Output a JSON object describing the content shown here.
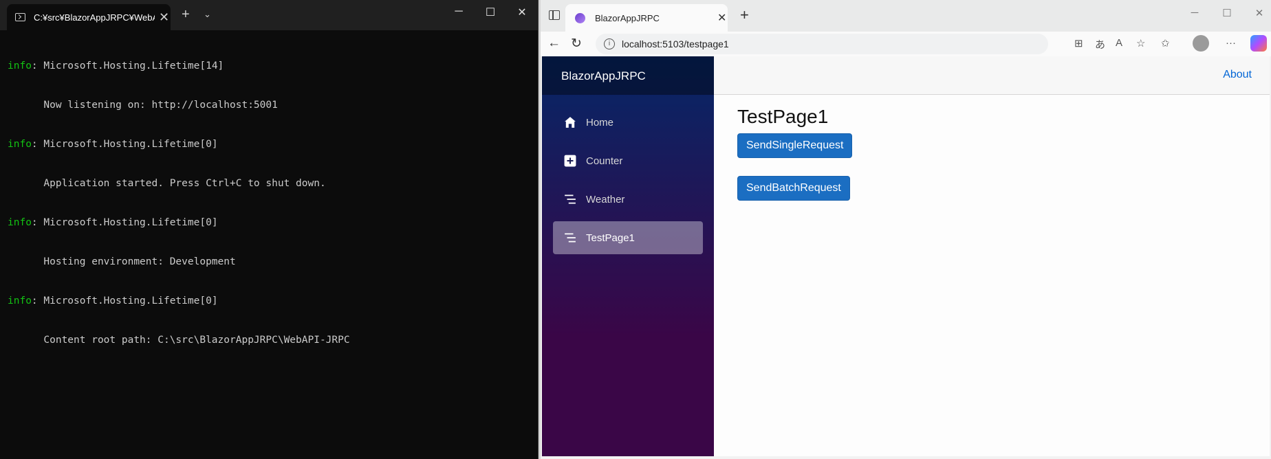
{
  "terminal": {
    "tab_title": "C:¥src¥BlazorAppJRPC¥WebAI",
    "lines": [
      {
        "level": "info",
        "text": ": Microsoft.Hosting.Lifetime[14]"
      },
      {
        "level": "",
        "text": "      Now listening on: http://localhost:5001"
      },
      {
        "level": "info",
        "text": ": Microsoft.Hosting.Lifetime[0]"
      },
      {
        "level": "",
        "text": "      Application started. Press Ctrl+C to shut down."
      },
      {
        "level": "info",
        "text": ": Microsoft.Hosting.Lifetime[0]"
      },
      {
        "level": "",
        "text": "      Hosting environment: Development"
      },
      {
        "level": "info",
        "text": ": Microsoft.Hosting.Lifetime[0]"
      },
      {
        "level": "",
        "text": "      Content root path: C:\\src\\BlazorAppJRPC\\WebAPI-JRPC"
      }
    ]
  },
  "browser": {
    "tab_title": "BlazorAppJRPC",
    "url": "localhost:5103/testpage1"
  },
  "app": {
    "brand": "BlazorAppJRPC",
    "nav": [
      {
        "label": "Home",
        "icon": "home-icon",
        "active": false
      },
      {
        "label": "Counter",
        "icon": "plus-square-icon",
        "active": false
      },
      {
        "label": "Weather",
        "icon": "list-icon",
        "active": false
      },
      {
        "label": "TestPage1",
        "icon": "list-icon",
        "active": true
      }
    ],
    "about_link": "About",
    "page_title": "TestPage1",
    "buttons": {
      "single": "SendSingleRequest",
      "batch": "SendBatchRequest"
    }
  },
  "colors": {
    "accent": "#1b6ec2",
    "link": "#0366d6",
    "sidebar_top": "#052767",
    "sidebar_bottom": "#3a0647",
    "terminal_level": "#13c313"
  }
}
